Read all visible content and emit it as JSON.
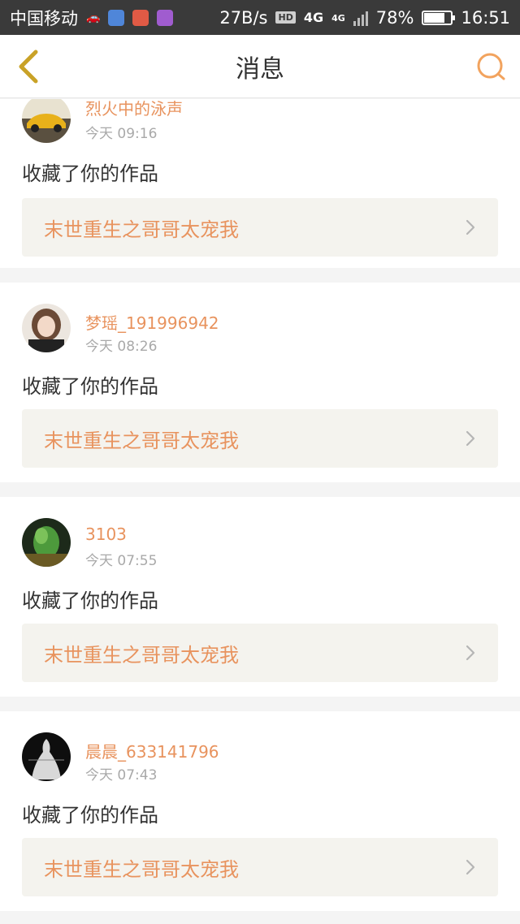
{
  "status_bar": {
    "carrier": "中国移动",
    "speed": "27B/s",
    "hd": "HD",
    "net1": "4G",
    "net2": "4G",
    "battery": "78%",
    "battery_level": 0.78,
    "time": "16:51"
  },
  "header": {
    "title": "消息"
  },
  "colors": {
    "accent": "#e8935e",
    "back_arrow": "#c9a227",
    "search": "#f2a35e",
    "box_bg": "#f4f3ee"
  },
  "messages": [
    {
      "username": "烈火中的泳声",
      "time": "今天 09:16",
      "action": "收藏了你的作品",
      "work_title": "末世重生之哥哥太宠我",
      "avatar": "yellow-car-avatar"
    },
    {
      "username": "梦瑶_191996942",
      "time": "今天 08:26",
      "action": "收藏了你的作品",
      "work_title": "末世重生之哥哥太宠我",
      "avatar": "girl-avatar"
    },
    {
      "username": "3103",
      "time": "今天 07:55",
      "action": "收藏了你的作品",
      "work_title": "末世重生之哥哥太宠我",
      "avatar": "green-landscape-avatar"
    },
    {
      "username": "晨晨_633141796",
      "time": "今天 07:43",
      "action": "收藏了你的作品",
      "work_title": "末世重生之哥哥太宠我",
      "avatar": "white-figure-avatar"
    }
  ]
}
